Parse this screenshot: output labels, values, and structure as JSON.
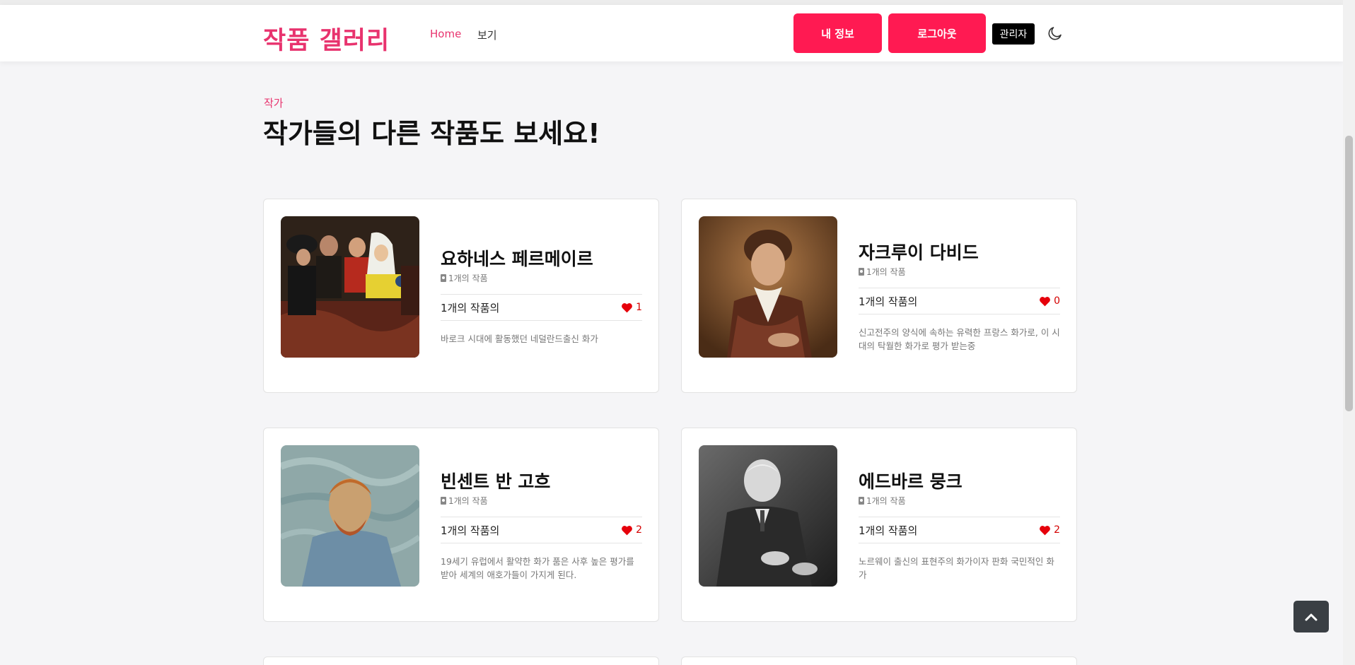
{
  "header": {
    "brand": "작품 갤러리",
    "nav": {
      "home": "Home",
      "view": "보기"
    },
    "buttons": {
      "my_info": "내 정보",
      "logout": "로그아웃",
      "admin": "관리자"
    },
    "theme_icon": "moon-icon",
    "accent_color": "#e8336e",
    "button_color": "#ff1a52"
  },
  "section": {
    "subtitle": "작가",
    "title": "작가들의 다른 작품도 보세요!"
  },
  "artists": [
    {
      "name": "요하네스 페르메이르",
      "works_count": "1개의 작품",
      "works_label": "1개의 작품의",
      "likes": "1",
      "description": "바로크 시대에 활동했던 네덜란드출신 화가"
    },
    {
      "name": "자크루이 다비드",
      "works_count": "1개의 작품",
      "works_label": "1개의 작품의",
      "likes": "0",
      "description": "신고전주의 양식에 속하는 유력한 프랑스 화가로, 이 시대의 탁월한 화가로 평가 받는중"
    },
    {
      "name": "빈센트 반 고흐",
      "works_count": "1개의 작품",
      "works_label": "1개의 작품의",
      "likes": "2",
      "description": "19세기 유럽에서 활약한 화가 품은 사후 높은 평가를 받아 세계의 애호가들이 가지게 된다."
    },
    {
      "name": "에드바르 뭉크",
      "works_count": "1개의 작품",
      "works_label": "1개의 작품의",
      "likes": "2",
      "description": "노르웨이 출신의 표현주의 화가이자 판화 국민적인 화가"
    }
  ],
  "icons": {
    "heart": "heart-icon",
    "book": "book-icon",
    "back_to_top": "chevron-up-icon"
  },
  "heart_color": "#d40000"
}
